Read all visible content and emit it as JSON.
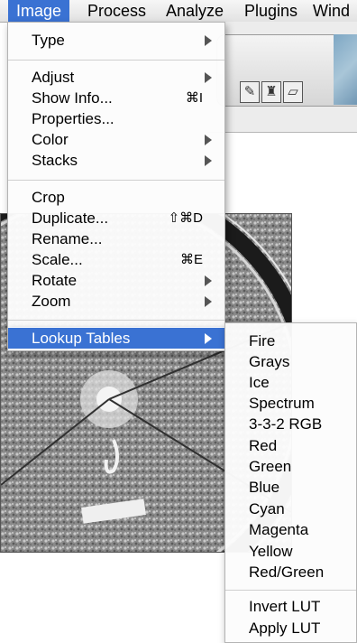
{
  "menubar": {
    "items": [
      "Image",
      "Process",
      "Analyze",
      "Plugins",
      "Wind"
    ],
    "active": "Image"
  },
  "image_menu": {
    "items": [
      {
        "label": "Type",
        "submenu": true
      },
      {
        "label": "Adjust",
        "submenu": true
      },
      {
        "label": "Show Info...",
        "shortcut": "⌘I"
      },
      {
        "label": "Properties..."
      },
      {
        "label": "Color",
        "submenu": true
      },
      {
        "label": "Stacks",
        "submenu": true
      },
      {
        "label": "Crop"
      },
      {
        "label": "Duplicate...",
        "shortcut": "⇧⌘D"
      },
      {
        "label": "Rename..."
      },
      {
        "label": "Scale...",
        "shortcut": "⌘E"
      },
      {
        "label": "Rotate",
        "submenu": true
      },
      {
        "label": "Zoom",
        "submenu": true
      },
      {
        "label": "Lookup Tables",
        "submenu": true,
        "selected": true
      }
    ]
  },
  "lookup_tables_submenu": {
    "items": [
      "Fire",
      "Grays",
      "Ice",
      "Spectrum",
      "3-3-2 RGB",
      "Red",
      "Green",
      "Blue",
      "Cyan",
      "Magenta",
      "Yellow",
      "Red/Green",
      "Invert LUT",
      "Apply LUT"
    ]
  },
  "toolbar": {
    "tools": [
      "pencil-icon",
      "brush-icon",
      "eraser-icon"
    ]
  },
  "colors": {
    "selection": "#3a72d3",
    "menu_bg": "#fcfcfc"
  }
}
